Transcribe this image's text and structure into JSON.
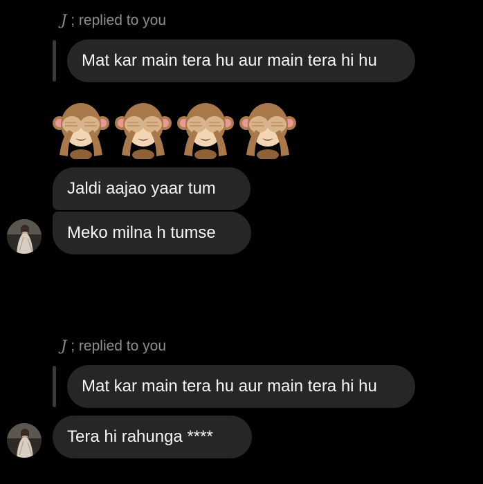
{
  "thread": {
    "reply_prefix": "J",
    "reply_suffix": " ; replied to you",
    "quoted_message": "Mat kar main tera hu aur main tera hi hu",
    "emoji_reaction": "🙈🙈🙈🙈",
    "messages": [
      "Jaldi aajao yaar tum",
      "Meko milna h tumse",
      "Tera hi rahunga ****"
    ]
  },
  "icons": {
    "emoji": "see-no-evil-monkey-icon",
    "avatar": "profile-photo"
  },
  "colors": {
    "background": "#000000",
    "bubble": "#262626",
    "text": "#f5f5f5",
    "caption": "#8e8e8e",
    "reply_bar": "#3a3a3a"
  }
}
